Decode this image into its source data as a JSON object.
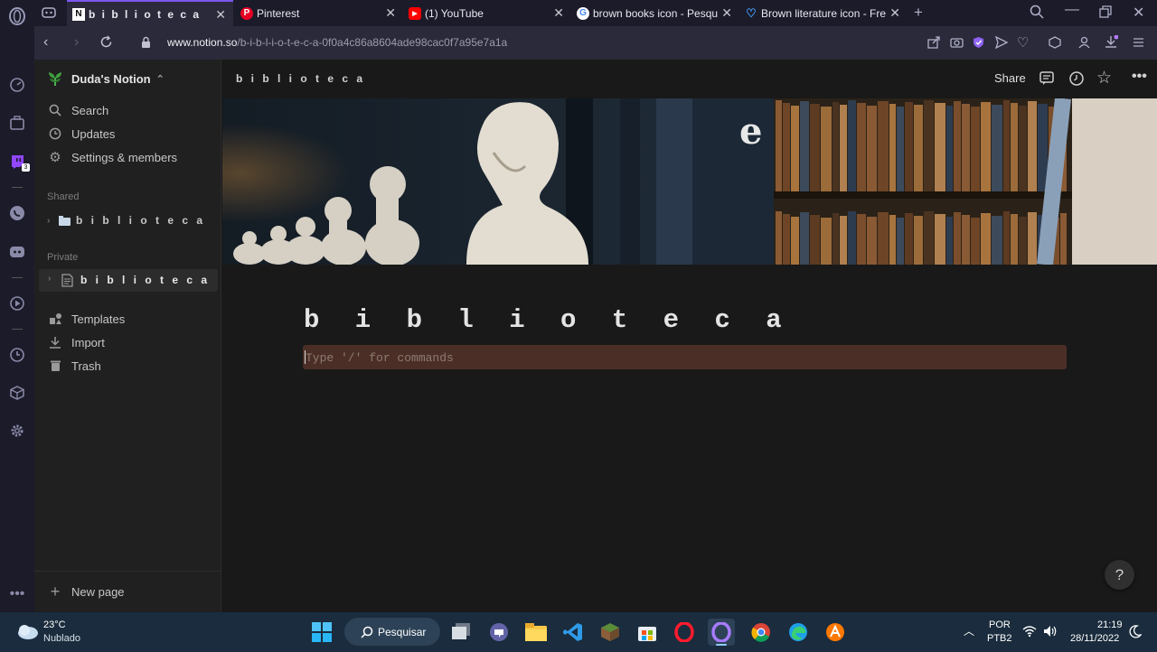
{
  "browser": {
    "tabs": [
      {
        "title": "b i b l i o t e c a",
        "icon": "notion-icon",
        "active": true
      },
      {
        "title": "Pinterest",
        "icon": "pinterest-icon"
      },
      {
        "title": "(1) YouTube",
        "icon": "youtube-icon"
      },
      {
        "title": "brown books icon - Pesqui",
        "icon": "google-icon"
      },
      {
        "title": "Brown literature icon - Free",
        "icon": "heart-icon"
      }
    ],
    "url_domain": "www.notion.so",
    "url_path": "/b-i-b-l-i-o-t-e-c-a-0f0a4c86a8604ade98cac0f7a95e7a1a",
    "twitch_badge": "3"
  },
  "notion": {
    "workspace": "Duda's Notion",
    "nav": {
      "search": "Search",
      "updates": "Updates",
      "settings": "Settings & members"
    },
    "shared_label": "Shared",
    "shared_page": "b i b l i o t e c a",
    "private_label": "Private",
    "private_page": "b i b l i o t e c a",
    "templates": "Templates",
    "import": "Import",
    "trash": "Trash",
    "new_page": "New page",
    "breadcrumb": "b i b l i o t e c a",
    "share": "Share",
    "title": "b i b l i o t e c a",
    "placeholder": "Type '/' for commands",
    "help": "?"
  },
  "taskbar": {
    "weather_temp": "23°C",
    "weather_desc": "Nublado",
    "search": "Pesquisar",
    "lang1": "POR",
    "lang2": "PTB2",
    "time": "21:19",
    "date": "28/11/2022"
  },
  "colors": {
    "accent": "#7d56f0",
    "cmd_bg": "#4b2f26",
    "taskbar": "#1a2c3d"
  }
}
